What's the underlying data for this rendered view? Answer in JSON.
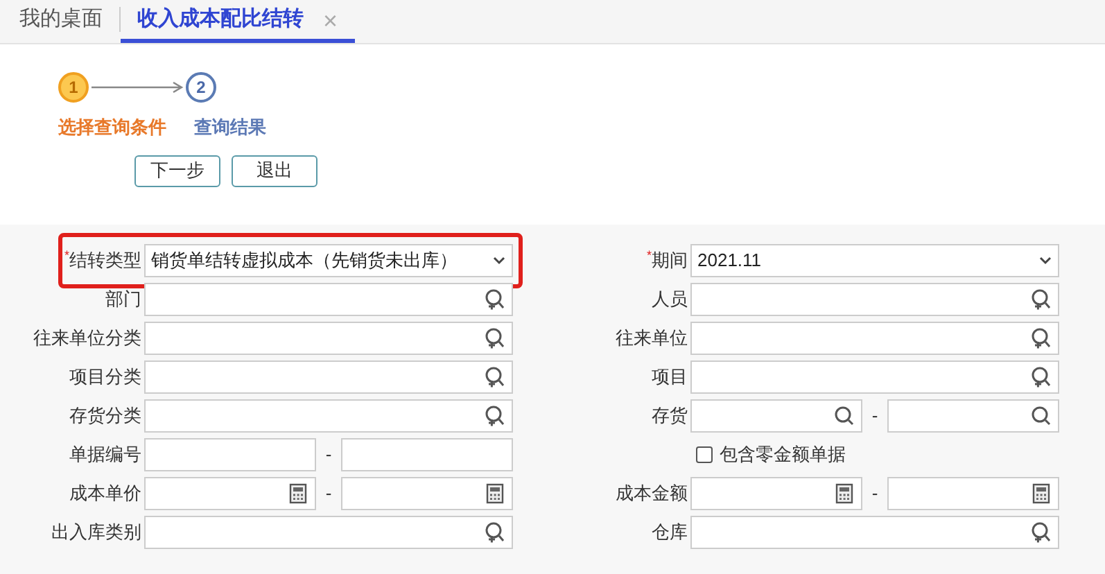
{
  "tabs": [
    {
      "label": "我的桌面",
      "selected": false
    },
    {
      "label": "收入成本配比结转",
      "selected": true,
      "close": "×"
    }
  ],
  "steps": [
    {
      "number": "1",
      "label": "选择查询条件",
      "selected": true
    },
    {
      "number": "2",
      "label": "查询结果",
      "selected": false
    }
  ],
  "buttons": [
    "下一步",
    "退出"
  ],
  "form_rows": [
    {
      "left": {
        "kind": "select",
        "label": "结转类型",
        "required_mark": "*",
        "value": "销货单结转虚拟成本（先销货未出库）",
        "highlighted": true
      },
      "right": {
        "kind": "select",
        "label": "期间",
        "required_mark": "*",
        "value": "2021.11"
      }
    },
    {
      "left": {
        "kind": "lookup",
        "label": "部门"
      },
      "right": {
        "kind": "lookup",
        "label": "人员"
      }
    },
    {
      "left": {
        "kind": "lookup",
        "label": "往来单位分类"
      },
      "right": {
        "kind": "lookup",
        "label": "往来单位"
      }
    },
    {
      "left": {
        "kind": "lookup",
        "label": "项目分类"
      },
      "right": {
        "kind": "lookup",
        "label": "项目"
      }
    },
    {
      "left": {
        "kind": "lookup",
        "label": "存货分类"
      },
      "right": {
        "kind": "search_range",
        "label": "存货",
        "separator": "-"
      }
    },
    {
      "left": {
        "kind": "text_range",
        "label": "单据编号",
        "separator": "-"
      },
      "right": {
        "kind": "checkbox",
        "label": "包含零金额单据",
        "checked": false
      }
    },
    {
      "left": {
        "kind": "number_range",
        "label": "成本单价",
        "separator": "-"
      },
      "right": {
        "kind": "number_range",
        "label": "成本金额",
        "separator": "-"
      }
    },
    {
      "left": {
        "kind": "lookup",
        "label": "出入库类别"
      },
      "right": {
        "kind": "lookup",
        "label": "仓库"
      }
    }
  ]
}
